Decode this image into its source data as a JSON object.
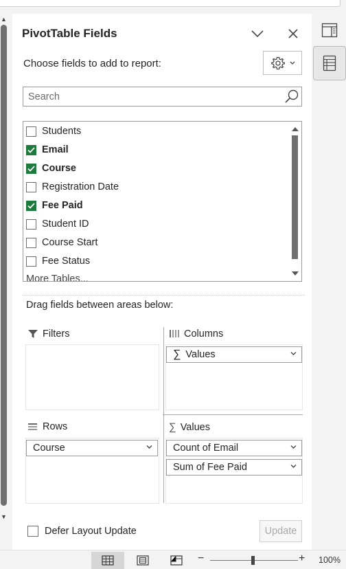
{
  "pane": {
    "title": "PivotTable Fields",
    "choose_label": "Choose fields to add to report:",
    "search_placeholder": "Search",
    "fields": [
      {
        "label": "Students",
        "checked": false
      },
      {
        "label": "Email",
        "checked": true
      },
      {
        "label": "Course",
        "checked": true
      },
      {
        "label": "Registration Date",
        "checked": false
      },
      {
        "label": "Fee Paid",
        "checked": true
      },
      {
        "label": "Student ID",
        "checked": false
      },
      {
        "label": "Course Start",
        "checked": false
      },
      {
        "label": "Fee Status",
        "checked": false
      }
    ],
    "more_tables": "More Tables...",
    "drag_label": "Drag fields between areas below:",
    "areas": {
      "filters": {
        "label": "Filters"
      },
      "columns": {
        "label": "Columns",
        "items": [
          "Values"
        ]
      },
      "rows": {
        "label": "Rows",
        "items": [
          "Course"
        ]
      },
      "values": {
        "label": "Values",
        "items": [
          "Count of Email",
          "Sum of Fee Paid"
        ]
      }
    },
    "defer_label": "Defer Layout Update",
    "update_label": "Update"
  },
  "status_bar": {
    "zoom_level": "100%"
  },
  "icons": {
    "settings": "gear-icon",
    "collapse": "chevron-down-icon",
    "close": "close-icon",
    "search": "search-icon"
  },
  "colors": {
    "check_green": "#1f7a3e"
  }
}
